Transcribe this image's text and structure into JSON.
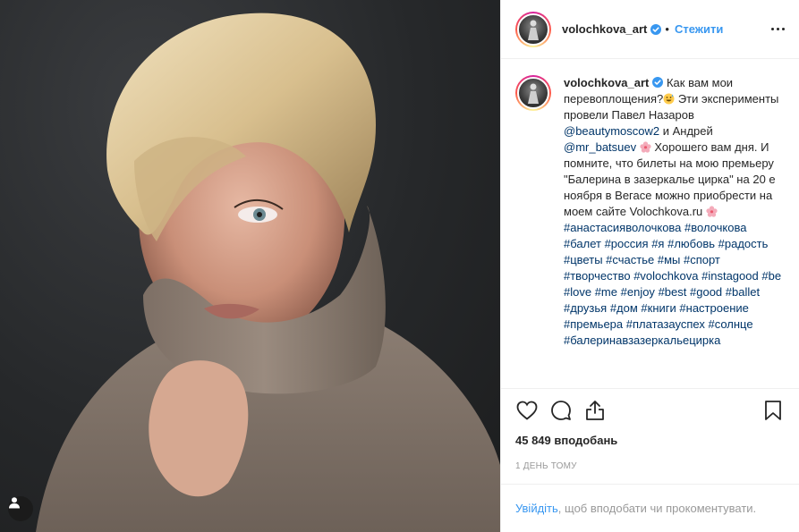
{
  "post": {
    "author": {
      "username": "volochkova_art",
      "verified": true,
      "follow_label": "Стежити"
    },
    "more_icon": "ellipsis-icon",
    "caption": {
      "username": "volochkova_art",
      "text_part1": " Как вам мои перевоплощения?",
      "text_part2": " Эти эксперименты провели Павел Назаров ",
      "mention1": "@beautymoscow2",
      "text_part3": " и Андрей ",
      "mention2": "@mr_batsuev",
      "text_part4": " Хорошего вам дня. И помните, что билеты на мою премьеру \"Балерина в зазеркалье цирка\" на 20 е ноября в Вегасе можно приобрести на моем сайте Volochkova.ru ",
      "hashtags": [
        "#анастасияволочкова",
        "#волочкова",
        "#балет",
        "#россия",
        "#я",
        "#любовь",
        "#радость",
        "#цветы",
        "#счастье",
        "#мы",
        "#спорт",
        "#творчество",
        "#volochkova",
        "#instagood",
        "#be",
        "#love",
        "#me",
        "#enjoy",
        "#best",
        "#good",
        "#ballet",
        "#друзья",
        "#дом",
        "#книги",
        "#настроение",
        "#премьера",
        "#платазауспех",
        "#солнце",
        "#балеринавзазеркальецирка"
      ]
    },
    "likes_text": "45 849 вподобань",
    "time_text": "1 день тому",
    "login_prompt": {
      "link_label": "Увійдіть",
      "rest": ", щоб вподобати чи прокоментувати."
    },
    "icons": [
      "heart-icon",
      "comment-icon",
      "share-icon",
      "bookmark-icon",
      "user-tag-icon"
    ],
    "colors": {
      "link_blue": "#3897f0",
      "hashtag_blue": "#003569",
      "text": "#262626",
      "muted": "#999999"
    }
  }
}
